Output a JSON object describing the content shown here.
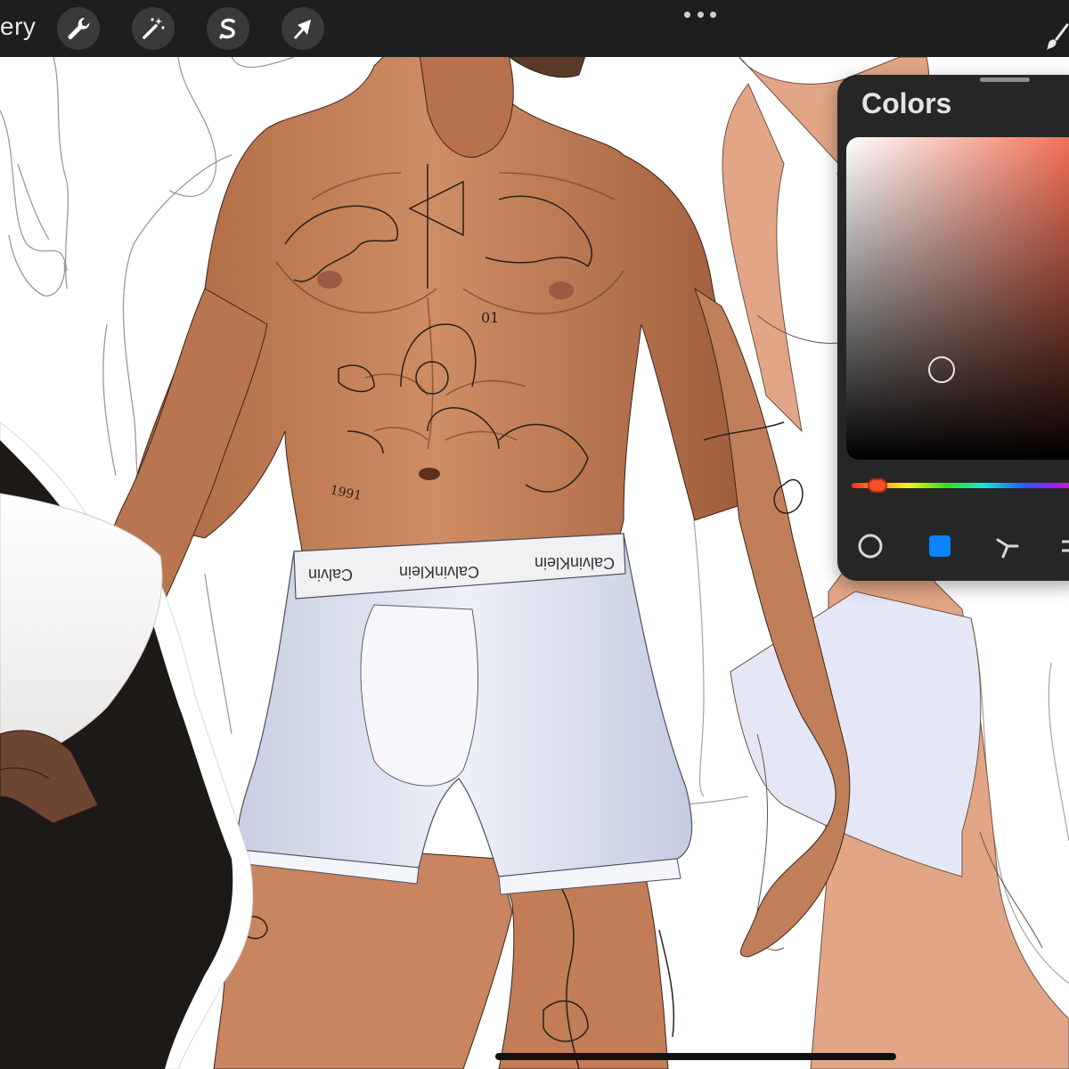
{
  "toolbar": {
    "gallery_label": "ery",
    "tools": [
      {
        "name": "wrench-icon",
        "label": "Actions"
      },
      {
        "name": "magic-wand-icon",
        "label": "Adjustments"
      },
      {
        "name": "selection-icon",
        "label": "Selection"
      },
      {
        "name": "transform-arrow-icon",
        "label": "Transform"
      }
    ],
    "more_icon": "more-dots-icon",
    "brush_icon": "brush-icon"
  },
  "canvas": {
    "waistband_labels": [
      "Calvin",
      "CalvinKlein",
      "CalvinKlein"
    ],
    "chest_numbers": "01",
    "belly_year": "1991",
    "colors": {
      "skin": "#c9845f",
      "skin_shadow": "#9a5a3c",
      "briefs": "#dfe3f1",
      "waistband": "#f1f1f4",
      "robe": "#1c1917",
      "flat_skin": "#e2a686",
      "sketch_line": "#9a9a9a"
    }
  },
  "colors_panel": {
    "title": "Colors",
    "current_color": "#8a3b2c",
    "hue_color": "#f2654a",
    "modes": [
      {
        "name": "disc-mode-icon",
        "active": false
      },
      {
        "name": "classic-mode-icon",
        "active": true
      },
      {
        "name": "harmony-mode-icon",
        "active": false
      },
      {
        "name": "value-mode-icon",
        "active": false
      }
    ],
    "accent": "#0a84ff"
  }
}
